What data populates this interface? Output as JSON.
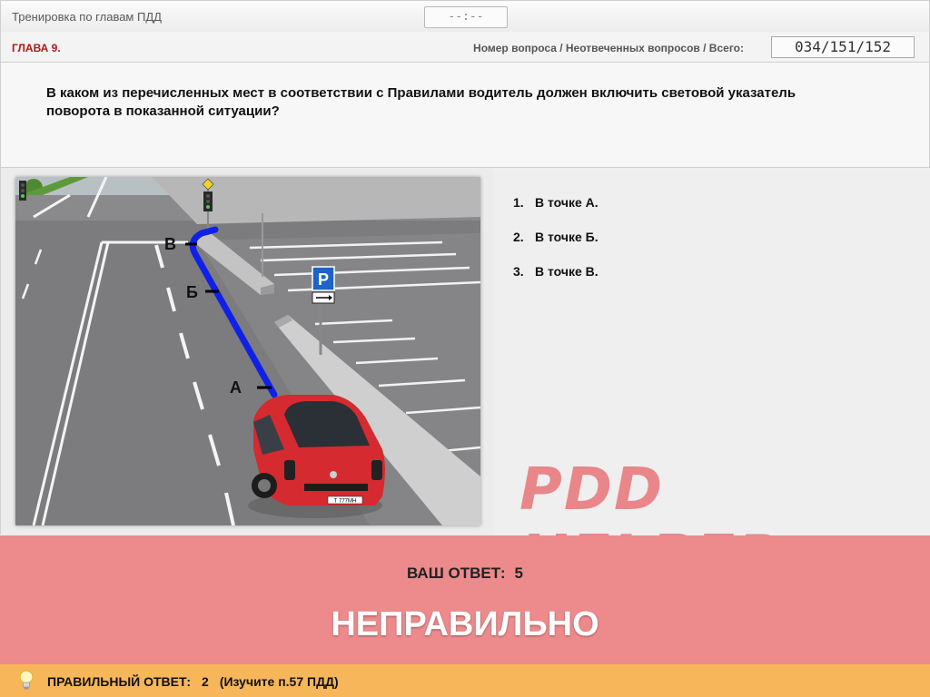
{
  "header": {
    "title": "Тренировка по главам ПДД",
    "timer": "--:--"
  },
  "chapter_bar": {
    "chapter": "ГЛАВА 9.",
    "counter_label": "Номер вопроса / Неотвеченных вопросов / Всего:",
    "counter_value": "034/151/152"
  },
  "question": {
    "text": "В каком из перечисленных мест в соответствии с Правилами водитель должен включить световой указатель поворота в показанной ситуации?"
  },
  "image": {
    "point_labels": [
      "А",
      "Б",
      "В"
    ],
    "sign_letter": "P",
    "plate_text": "Т 777МН"
  },
  "answers": [
    {
      "num": "1.",
      "text": "В точке А."
    },
    {
      "num": "2.",
      "text": "В точке Б."
    },
    {
      "num": "3.",
      "text": "В точке В."
    }
  ],
  "watermark": "PDD HELPER",
  "result": {
    "your_answer_label": "ВАШ  ОТВЕТ:",
    "your_answer_value": "5",
    "verdict": "НЕПРАВИЛЬНО"
  },
  "correct": {
    "label": "ПРАВИЛЬНЫЙ ОТВЕТ:",
    "value": "2",
    "hint": "(Изучите п.57 ПДД)"
  },
  "colors": {
    "chapter": "#b01919",
    "result_bg": "#ec8a8c",
    "correct_bg": "#f8b65a",
    "route": "#1020e8",
    "car": "#d42a30"
  }
}
